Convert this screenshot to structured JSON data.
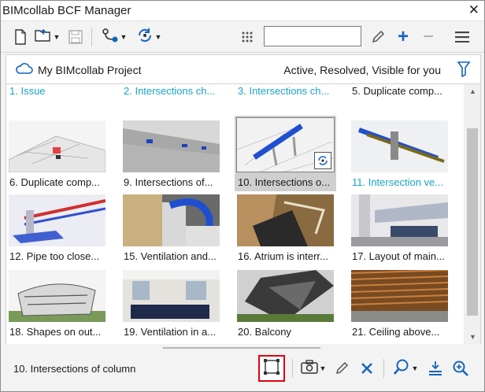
{
  "window": {
    "title": "BIMcollab BCF Manager",
    "close_glyph": "✕"
  },
  "toolbar": {
    "icons": [
      "new-document-icon",
      "open-folder-icon",
      "save-icon",
      "connect-icon",
      "sync-icon",
      "grid-view-icon",
      "edit-pencil-icon",
      "add-icon",
      "remove-icon",
      "hamburger-menu-icon"
    ],
    "search": {
      "value": "",
      "placeholder": ""
    },
    "plus_glyph": "+",
    "minus_glyph": "−"
  },
  "project": {
    "name": "My BIMcollab Project",
    "filter": "Active, Resolved, Visible for you"
  },
  "issues": {
    "partial_row": [
      {
        "label": "1. Issue",
        "teal": true
      },
      {
        "label": "2. Intersections ch...",
        "teal": true
      },
      {
        "label": "3. Intersections ch...",
        "teal": true
      },
      {
        "label": "5. Duplicate comp...",
        "teal": false
      }
    ],
    "rows": [
      [
        {
          "label": "6. Duplicate comp...",
          "teal": false,
          "selected": false
        },
        {
          "label": "9. Intersections of...",
          "teal": false,
          "selected": false
        },
        {
          "label": "10. Intersections o...",
          "teal": false,
          "selected": true
        },
        {
          "label": "11. Intersection ve...",
          "teal": true,
          "selected": false
        }
      ],
      [
        {
          "label": "12. Pipe too close...",
          "teal": false,
          "selected": false
        },
        {
          "label": "15. Ventilation and...",
          "teal": false,
          "selected": false
        },
        {
          "label": "16. Atrium is interr...",
          "teal": false,
          "selected": false
        },
        {
          "label": "17. Layout of main...",
          "teal": false,
          "selected": false
        }
      ],
      [
        {
          "label": "18. Shapes on out...",
          "teal": false,
          "selected": false
        },
        {
          "label": "19. Ventilation in a...",
          "teal": false,
          "selected": false
        },
        {
          "label": "20. Balcony",
          "teal": false,
          "selected": false
        },
        {
          "label": "21. Ceiling above...",
          "teal": false,
          "selected": false
        }
      ]
    ]
  },
  "bottom": {
    "selected_issue": "10. Intersections of column",
    "icons": [
      "area-select-icon",
      "camera-icon",
      "edit-pencil-icon",
      "delete-x-icon",
      "zoom-icon",
      "level-icon",
      "zoom-in-icon"
    ]
  },
  "colors": {
    "accent_blue": "#1565c0",
    "teal_label": "#1aa3c7",
    "highlight_red": "#e0000f"
  }
}
